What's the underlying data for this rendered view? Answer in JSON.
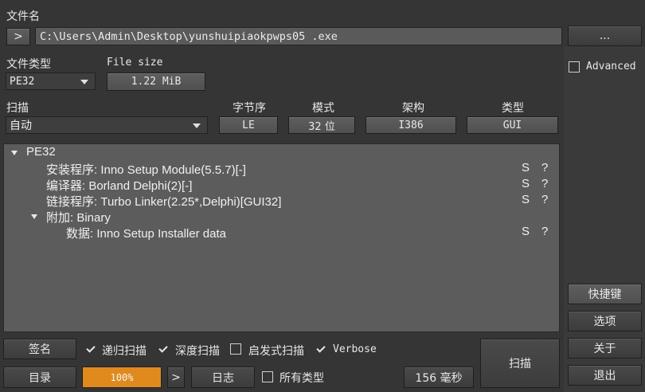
{
  "file": {
    "label": "文件名",
    "expand_glyph": ">",
    "path": "C:\\Users\\Admin\\Desktop\\yunshuipiaokpwps05 .exe",
    "browse_label": "..."
  },
  "filetype": {
    "label": "文件类型",
    "value": "PE32"
  },
  "filesize": {
    "label": "File size",
    "value": "1.22 MiB"
  },
  "advanced": {
    "label": "Advanced",
    "checked": false
  },
  "scan": {
    "label": "扫描",
    "value": "自动"
  },
  "info_columns": [
    {
      "label": "字节序",
      "value": "LE"
    },
    {
      "label": "模式",
      "value": "32 位"
    },
    {
      "label": "架构",
      "value": "I386"
    },
    {
      "label": "类型",
      "value": "GUI"
    }
  ],
  "tree": {
    "root": "PE32",
    "items": [
      {
        "text": "安装程序: Inno Setup Module(5.5.7)[-]",
        "s": "S",
        "q": "?"
      },
      {
        "text": "编译器: Borland Delphi(2)[-]",
        "s": "S",
        "q": "?"
      },
      {
        "text": "链接程序: Turbo Linker(2.25*,Delphi)[GUI32]",
        "s": "S",
        "q": "?"
      }
    ],
    "overlay": "附加: Binary",
    "overlay_child": {
      "text": "数据: Inno Setup Installer data",
      "s": "S",
      "q": "?"
    }
  },
  "bottom": {
    "signature_label": "签名",
    "recursive_label": "递归扫描",
    "deep_label": "深度扫描",
    "heuristic_label": "启发式扫描",
    "verbose_label": "Verbose",
    "directory_label": "目录",
    "progress_text": "100%",
    "progress": 1.0,
    "next_glyph": ">",
    "log_label": "日志",
    "alltypes_label": "所有类型",
    "time_label": "156 毫秒",
    "scan_button": "扫描"
  },
  "side": {
    "shortcuts_label": "快捷键",
    "options_label": "选项",
    "about_label": "关于",
    "exit_label": "退出"
  },
  "colors": {
    "progress": "#e08a1e",
    "tree_bg": "#5c5c5c",
    "window_bg": "#353535"
  }
}
